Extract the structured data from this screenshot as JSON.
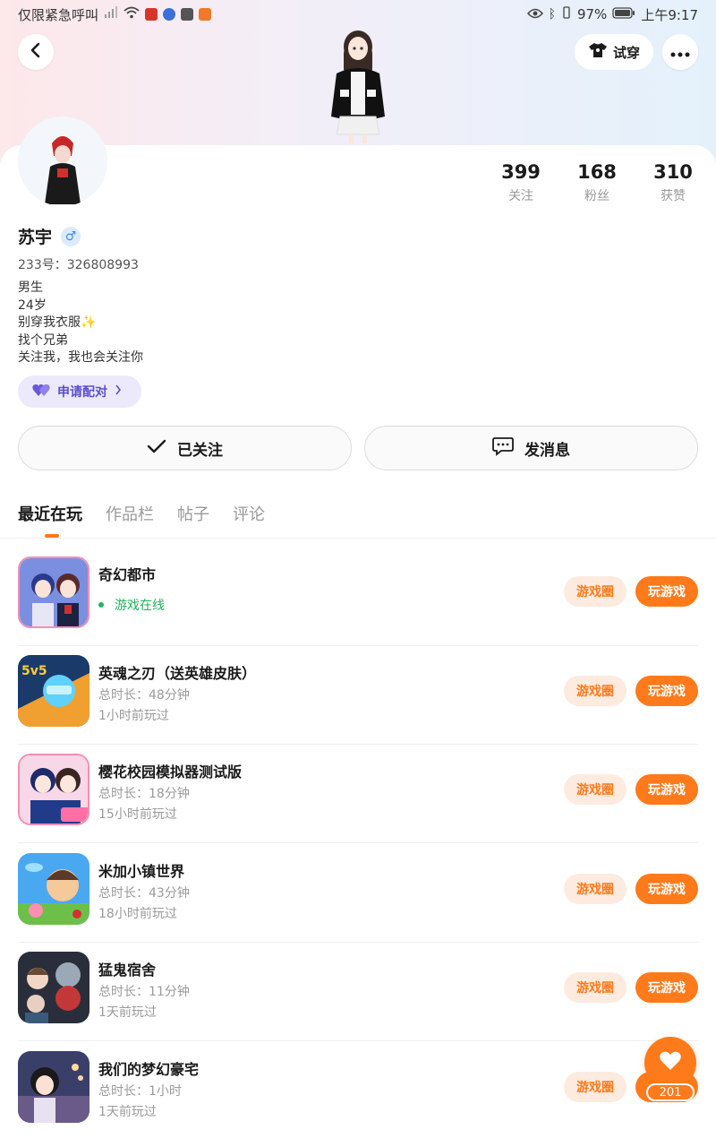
{
  "status_bar": {
    "carrier": "仅限紧急呼叫",
    "battery": "97%",
    "time": "上午9:17"
  },
  "header": {
    "back_icon": "chevron-left-icon",
    "try_on_label": "试穿",
    "more_icon": "more-dots-icon"
  },
  "profile": {
    "name": "苏宇",
    "gender_symbol": "♂",
    "uid": "233号：326808993",
    "bio_lines": [
      "男生",
      "24岁",
      "别穿我衣服✨",
      "找个兄弟",
      "关注我，我也会关注你"
    ],
    "pair_label": "申请配对"
  },
  "stats": [
    {
      "value": "399",
      "label": "关注"
    },
    {
      "value": "168",
      "label": "粉丝"
    },
    {
      "value": "310",
      "label": "获赞"
    }
  ],
  "actions": {
    "following_label": "已关注",
    "message_label": "发消息"
  },
  "tabs": [
    {
      "label": "最近在玩",
      "active": true
    },
    {
      "label": "作品栏",
      "active": false
    },
    {
      "label": "帖子",
      "active": false
    },
    {
      "label": "评论",
      "active": false
    }
  ],
  "games": [
    {
      "name": "奇幻都市",
      "line1": "游戏在线",
      "line2": "",
      "online": true
    },
    {
      "name": "英魂之刃（送英雄皮肤）",
      "line1": "总时长：48分钟",
      "line2": "1小时前玩过",
      "online": false
    },
    {
      "name": "樱花校园模拟器测试版",
      "line1": "总时长：18分钟",
      "line2": "15小时前玩过",
      "online": false
    },
    {
      "name": "米加小镇世界",
      "line1": "总时长：43分钟",
      "line2": "18小时前玩过",
      "online": false
    },
    {
      "name": "猛鬼宿舍",
      "line1": "总时长：11分钟",
      "line2": "1天前玩过",
      "online": false
    },
    {
      "name": "我们的梦幻豪宅",
      "line1": "总时长：1小时",
      "line2": "1天前玩过",
      "online": false
    }
  ],
  "game_buttons": {
    "circle_label": "游戏圈",
    "play_label": "玩游戏"
  },
  "fab": {
    "icon": "heart-icon",
    "count": "201"
  },
  "colors": {
    "accent": "#ff7a1a",
    "online_green": "#22b35e",
    "pair_purple": "#5b4fc8"
  }
}
